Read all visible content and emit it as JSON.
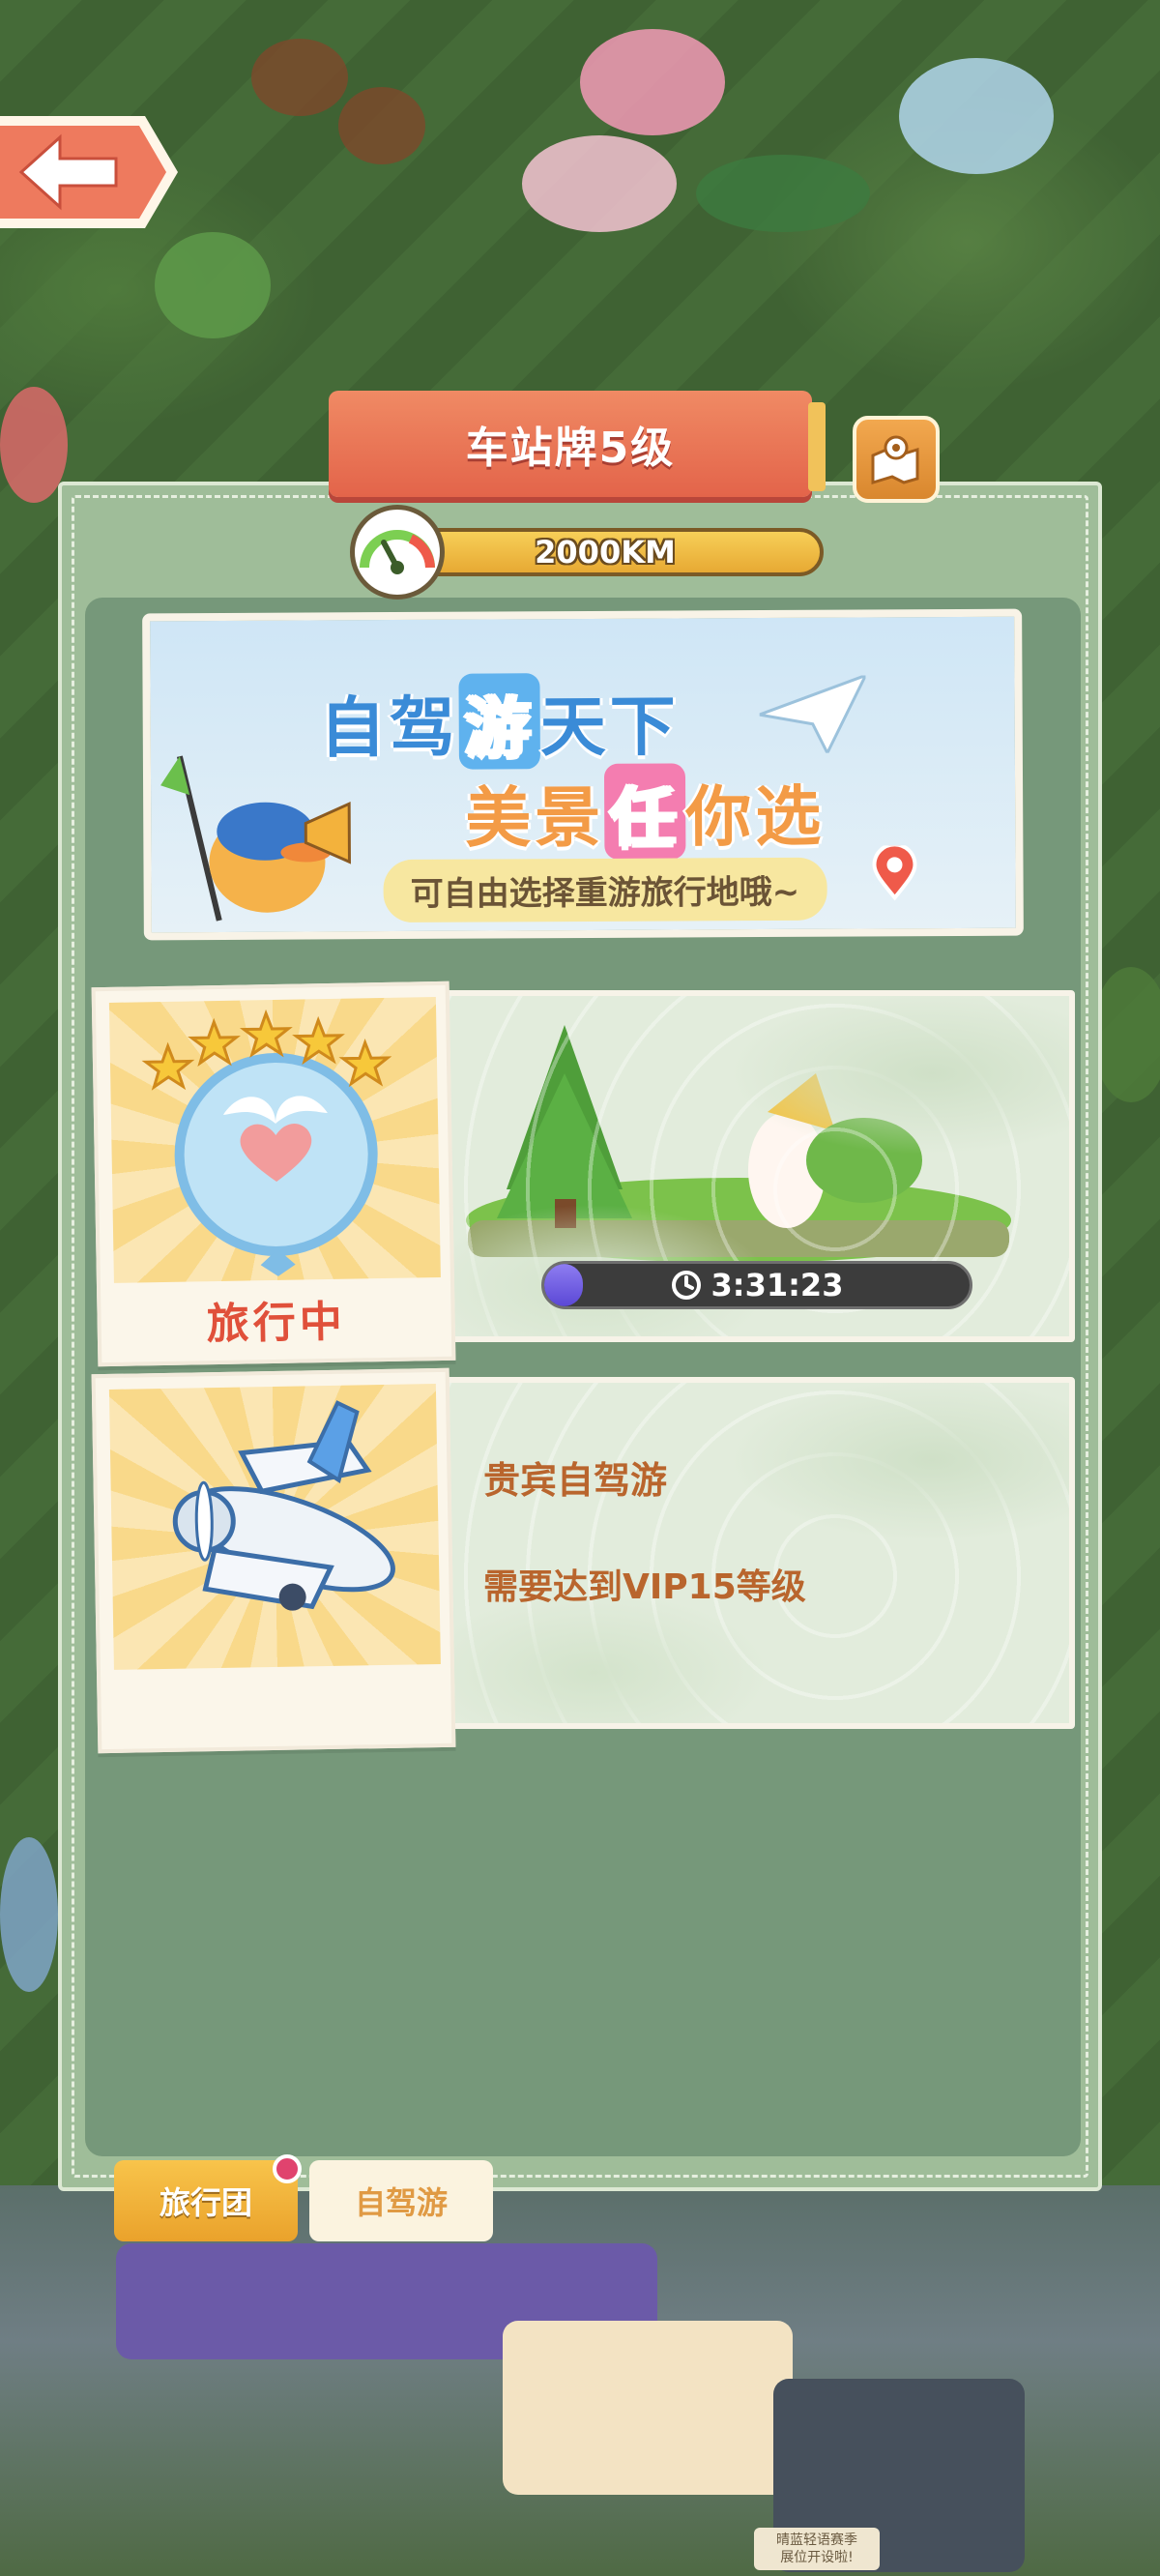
{
  "header": {
    "title": "车站牌5级",
    "distance": "2000KM"
  },
  "banner": {
    "line1_a": "自驾",
    "line1_hl": "游",
    "line1_b": "天下",
    "line2_a": "美景",
    "line2_hl": "任",
    "line2_b": "你选",
    "subtitle": "可自由选择重游旅行地哦~"
  },
  "cards": [
    {
      "status": "旅行中",
      "stars": 5,
      "timer": "3:31:23",
      "timer_progress": 0.09
    },
    {
      "title": "贵宾自驾游",
      "requirement": "需要达到VIP15等级"
    }
  ],
  "tabs": [
    {
      "label": "旅行团",
      "active": true,
      "has_badge": true
    },
    {
      "label": "自驾游",
      "active": false,
      "has_badge": false
    }
  ],
  "footer_sign": "晴蓝轻语赛季\n展位开设啦!",
  "colors": {
    "panel": "#9fbd99",
    "inner_panel": "#76987a",
    "ribbon": "#e3644a",
    "accent_gold": "#f1b33b",
    "status_red": "#e0503a"
  }
}
